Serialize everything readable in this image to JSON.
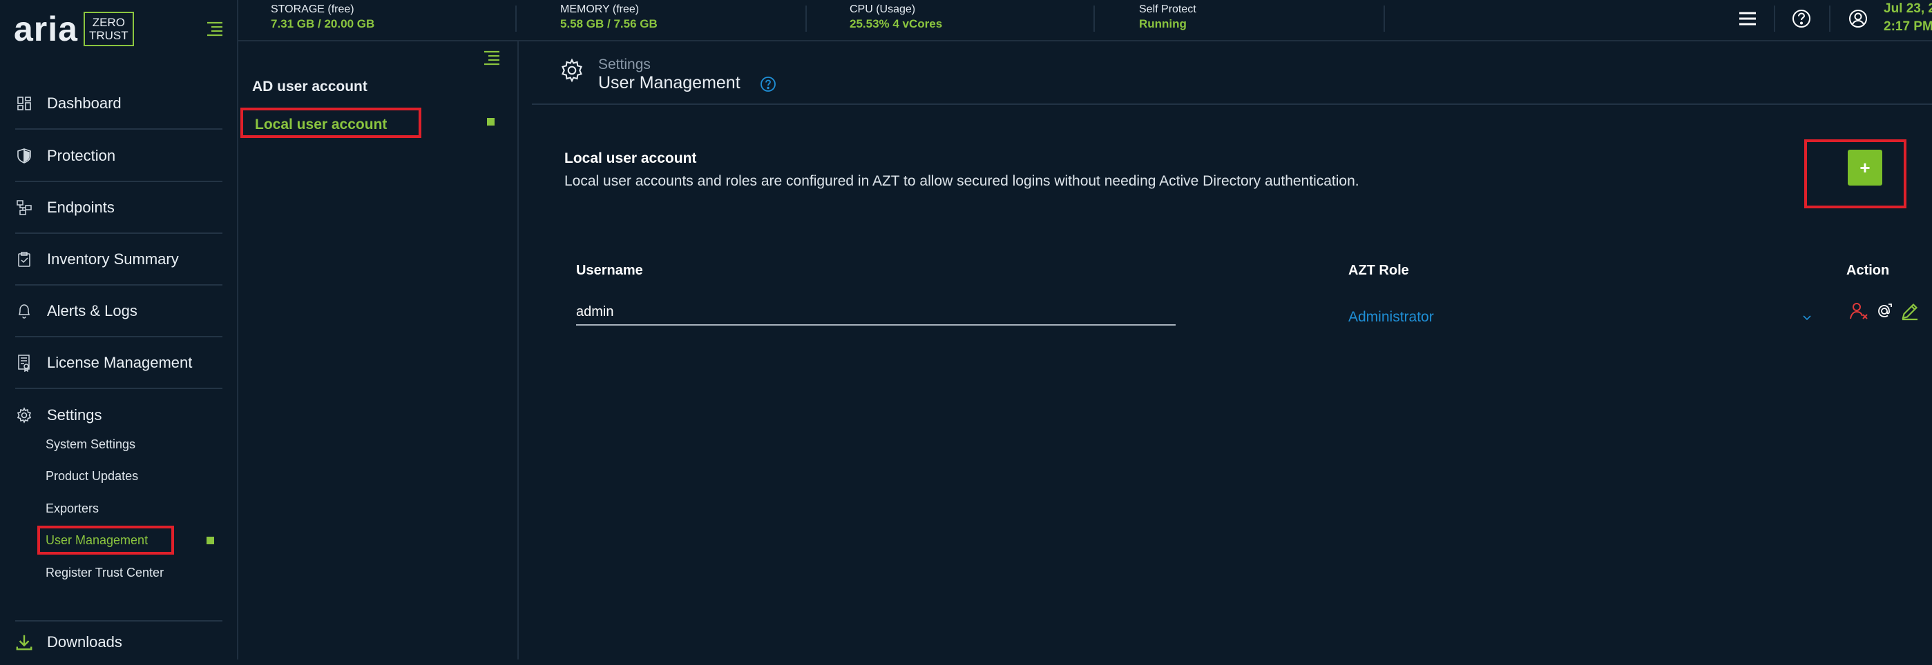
{
  "app": {
    "logo_main": "aria",
    "logo_badge_line1": "ZERO",
    "logo_badge_line2": "TRUST"
  },
  "colors": {
    "accent": "#8bc53f",
    "background": "#0c1a28",
    "highlight": "#e0202a",
    "link": "#1f8fd6",
    "danger": "#e03a3a"
  },
  "sidebar": {
    "items": [
      {
        "label": "Dashboard",
        "icon": "dashboard-icon"
      },
      {
        "label": "Protection",
        "icon": "shield-icon"
      },
      {
        "label": "Endpoints",
        "icon": "endpoints-icon"
      },
      {
        "label": "Inventory Summary",
        "icon": "clipboard-icon"
      },
      {
        "label": "Alerts & Logs",
        "icon": "bell-icon"
      },
      {
        "label": "License Management",
        "icon": "license-icon"
      },
      {
        "label": "Settings",
        "icon": "gear-icon"
      }
    ],
    "settings_sub": [
      {
        "label": "System Settings"
      },
      {
        "label": "Product Updates"
      },
      {
        "label": "Exporters"
      },
      {
        "label": "User Management"
      },
      {
        "label": "Register Trust Center"
      }
    ],
    "downloads": {
      "label": "Downloads",
      "icon": "download-icon"
    }
  },
  "topbar": {
    "stats": [
      {
        "title": "STORAGE (free)",
        "value": "7.31 GB / 20.00 GB"
      },
      {
        "title": "MEMORY (free)",
        "value": "5.58 GB / 7.56 GB"
      },
      {
        "title": "CPU (Usage)",
        "value": "25.53% 4 vCores"
      },
      {
        "title": "Self Protect",
        "value": "Running"
      }
    ],
    "date": "Jul 23, 2",
    "time": "2:17 PM"
  },
  "subpanel": {
    "items": [
      {
        "label": "AD user account"
      },
      {
        "label": "Local user account"
      }
    ]
  },
  "main": {
    "breadcrumb": "Settings",
    "title": "User Management",
    "section_title": "Local user account",
    "section_desc": "Local user accounts and roles are configured in AZT to allow secured logins without needing Active Directory authentication.",
    "add_button": "+",
    "table": {
      "headers": [
        "Username",
        "AZT Role",
        "Action"
      ],
      "rows": [
        {
          "username": "admin",
          "role": "Administrator"
        }
      ]
    }
  }
}
